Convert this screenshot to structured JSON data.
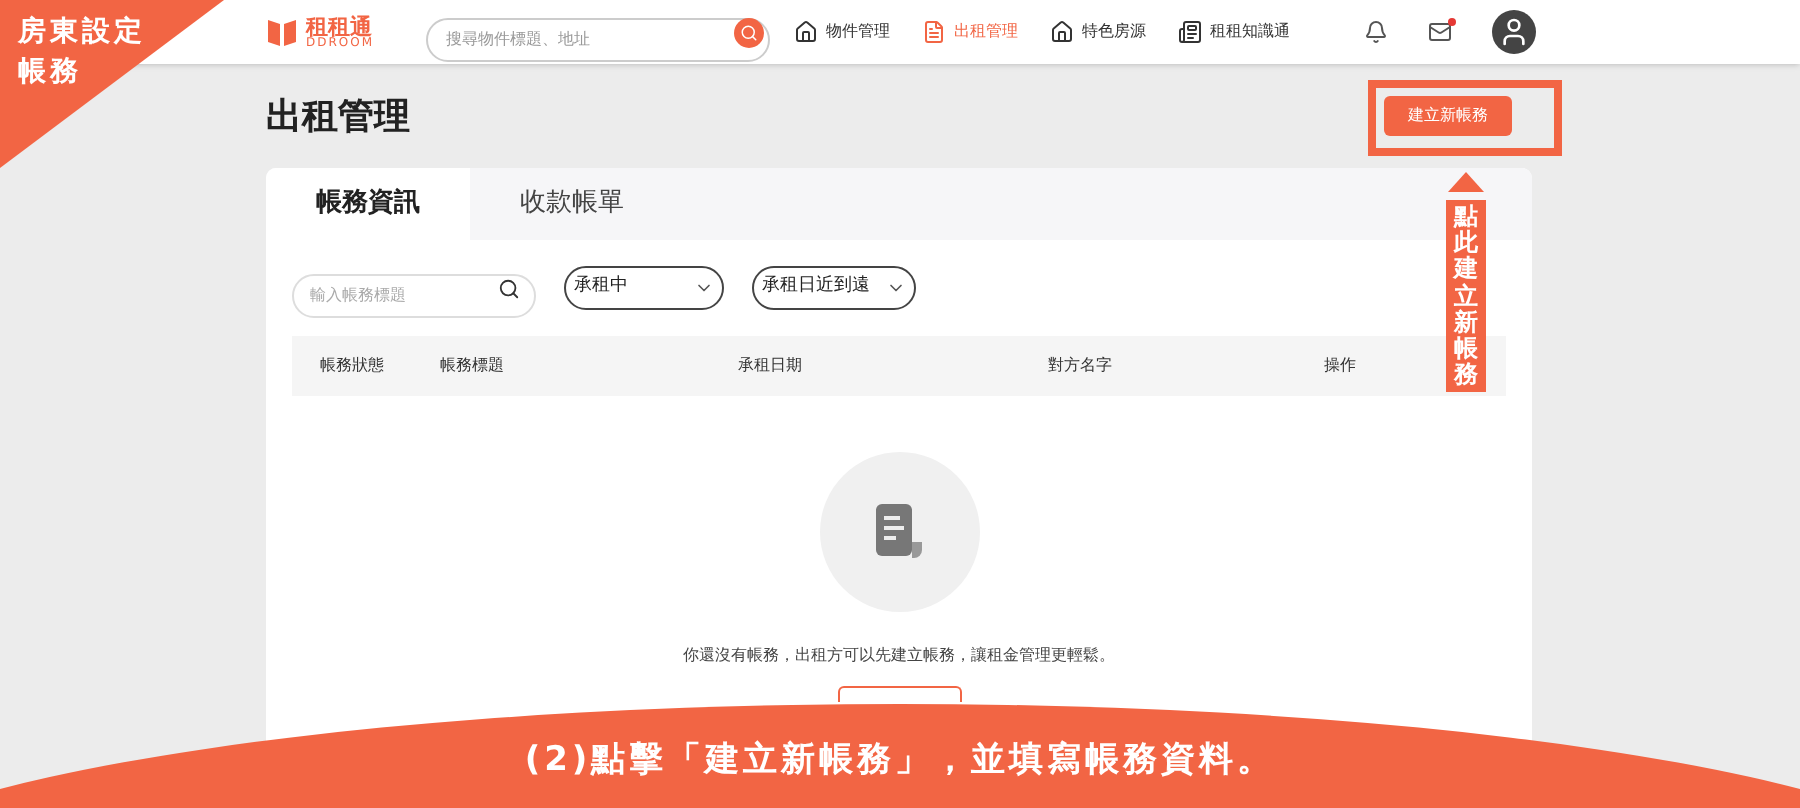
{
  "header": {
    "logo": {
      "name": "租租通",
      "sub": "DDROOM"
    },
    "search": {
      "placeholder": "搜尋物件標題、地址"
    },
    "nav": [
      {
        "label": "物件管理",
        "selected": false,
        "kind": "house"
      },
      {
        "label": "出租管理",
        "selected": true,
        "kind": "doc"
      },
      {
        "label": "特色房源",
        "selected": false,
        "kind": "house"
      },
      {
        "label": "租租知識通",
        "selected": false,
        "kind": "news"
      }
    ],
    "mail": {
      "unread": true
    }
  },
  "page_title": "出租管理",
  "create_button": "建立新帳務",
  "tabs": [
    {
      "label": "帳務資訊",
      "selected": true
    },
    {
      "label": "收款帳單",
      "selected": false
    }
  ],
  "filters": {
    "search": {
      "placeholder": "輸入帳務標題"
    },
    "dropdowns": [
      {
        "value": "承租中"
      },
      {
        "value": "承租日近到遠"
      }
    ]
  },
  "table": {
    "columns": [
      "帳務狀態",
      "帳務標題",
      "承租日期",
      "對方名字",
      "操作"
    ]
  },
  "empty_message": "你還沒有帳務，出租方可以先建立帳務，讓租金管理更輕鬆。",
  "tutorial": {
    "corner_label_lines": [
      "房東設定",
      "帳務"
    ],
    "callout": "點此建立新帳務",
    "banner": "(2)點擊「建立新帳務」，並填寫帳務資料。"
  }
}
